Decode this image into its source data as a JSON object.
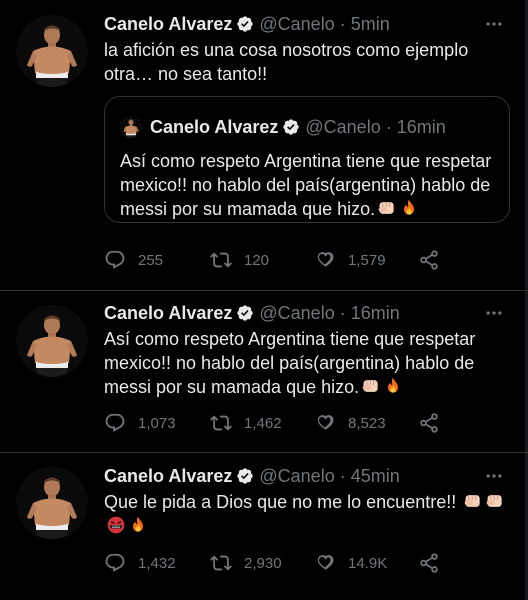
{
  "icons": {
    "verified": "verified-badge-icon",
    "reply": "reply-icon",
    "retweet": "retweet-icon",
    "like": "heart-icon",
    "share": "share-icon",
    "more": "more-options-icon"
  },
  "colors": {
    "background": "#000000",
    "text": "#e7e9ea",
    "muted": "#71767b",
    "divider": "#2f3336"
  },
  "tweets": [
    {
      "name": "Canelo Alvarez",
      "handle": "@Canelo",
      "dot": "·",
      "time": "5min",
      "text": "la afición es una cosa nosotros como ejemplo\notra… no sea tanto!!",
      "quote": {
        "name": "Canelo Alvarez",
        "handle": "@Canelo",
        "dot": "·",
        "time": "16min",
        "text": "Así como respeto Argentina tiene que respetar mexico!! no hablo del país(argentina) hablo de messi por su mamada que hizo."
      },
      "replies": "255",
      "retweets": "120",
      "likes": "1,579"
    },
    {
      "name": "Canelo Alvarez",
      "handle": "@Canelo",
      "dot": "·",
      "time": "16min",
      "text": "Así como respeto Argentina tiene que respetar mexico!! no hablo del país(argentina) hablo de messi por su mamada que hizo.",
      "replies": "1,073",
      "retweets": "1,462",
      "likes": "8,523"
    },
    {
      "name": "Canelo Alvarez",
      "handle": "@Canelo",
      "dot": "·",
      "time": "45min",
      "text": "Que le pida a Dios que no me lo encuentre!!",
      "replies": "1,432",
      "retweets": "2,930",
      "likes": "14.9K"
    }
  ]
}
